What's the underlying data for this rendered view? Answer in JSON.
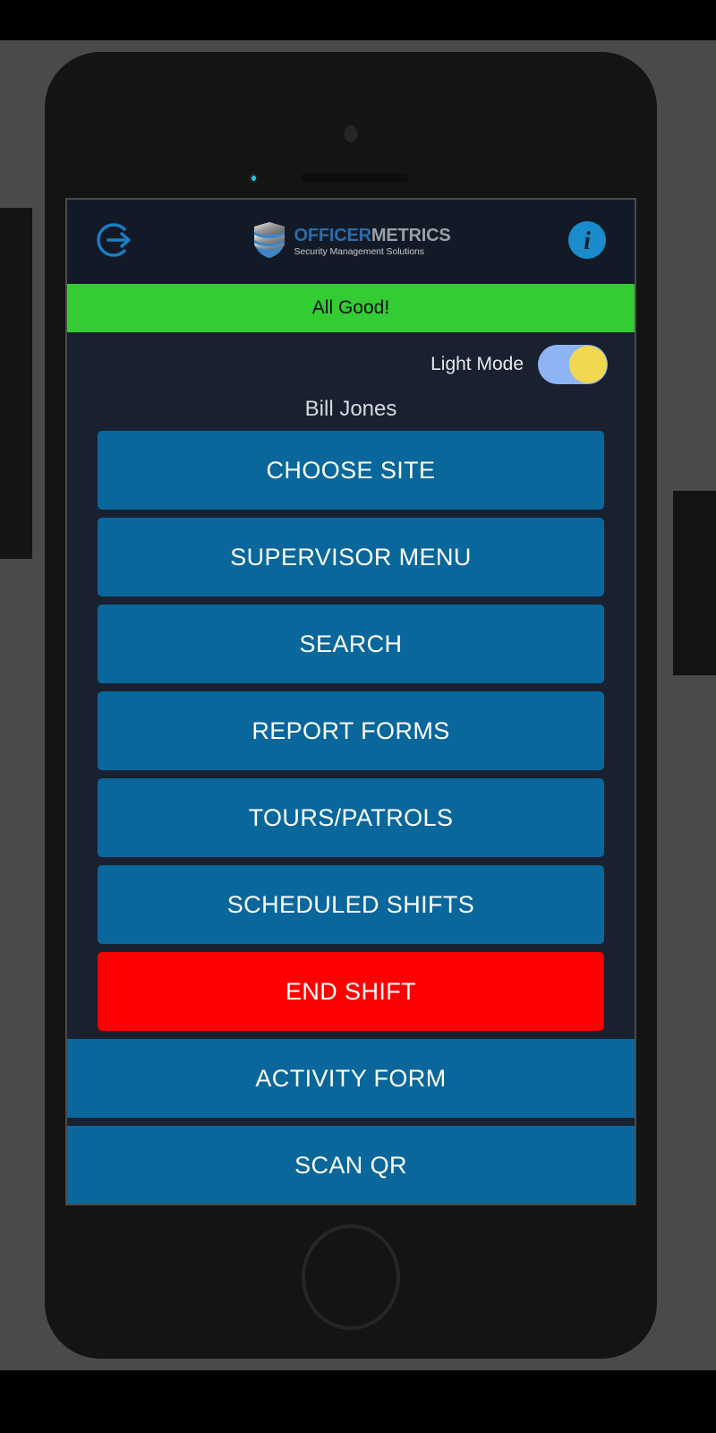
{
  "device": {
    "name": "smartphone-mockup"
  },
  "app": {
    "header": {
      "logout_icon": "logout-arrow-icon",
      "info_icon": "info-icon",
      "brand": {
        "shield_icon": "shield-logo-icon",
        "title_part1": "OFFICER",
        "title_part2": "METRICS",
        "subtitle": "Security Management Solutions"
      }
    },
    "status_banner": {
      "text": "All Good!",
      "color": "#33cc33",
      "text_color": "#0d0d0d"
    },
    "settings": {
      "light_mode_label": "Light Mode",
      "light_mode_on": true,
      "track_color": "#8fb4f5",
      "knob_color": "#f2d750"
    },
    "user": {
      "name": "Bill Jones"
    },
    "menu": {
      "primary_color": "#0a679c",
      "danger_color": "#ff0000",
      "items": [
        {
          "label": "CHOOSE SITE",
          "style": "primary",
          "name": "choose-site-button"
        },
        {
          "label": "SUPERVISOR MENU",
          "style": "primary",
          "name": "supervisor-menu-button"
        },
        {
          "label": "SEARCH",
          "style": "primary",
          "name": "search-button"
        },
        {
          "label": "REPORT FORMS",
          "style": "primary",
          "name": "report-forms-button"
        },
        {
          "label": "TOURS/PATROLS",
          "style": "primary",
          "name": "tours-patrols-button"
        },
        {
          "label": "SCHEDULED SHIFTS",
          "style": "primary",
          "name": "scheduled-shifts-button"
        },
        {
          "label": "END SHIFT",
          "style": "danger",
          "name": "end-shift-button"
        }
      ],
      "full_width_items": [
        {
          "label": "ACTIVITY FORM",
          "style": "primary",
          "name": "activity-form-button"
        },
        {
          "label": "SCAN QR",
          "style": "primary",
          "name": "scan-qr-button"
        }
      ]
    }
  }
}
